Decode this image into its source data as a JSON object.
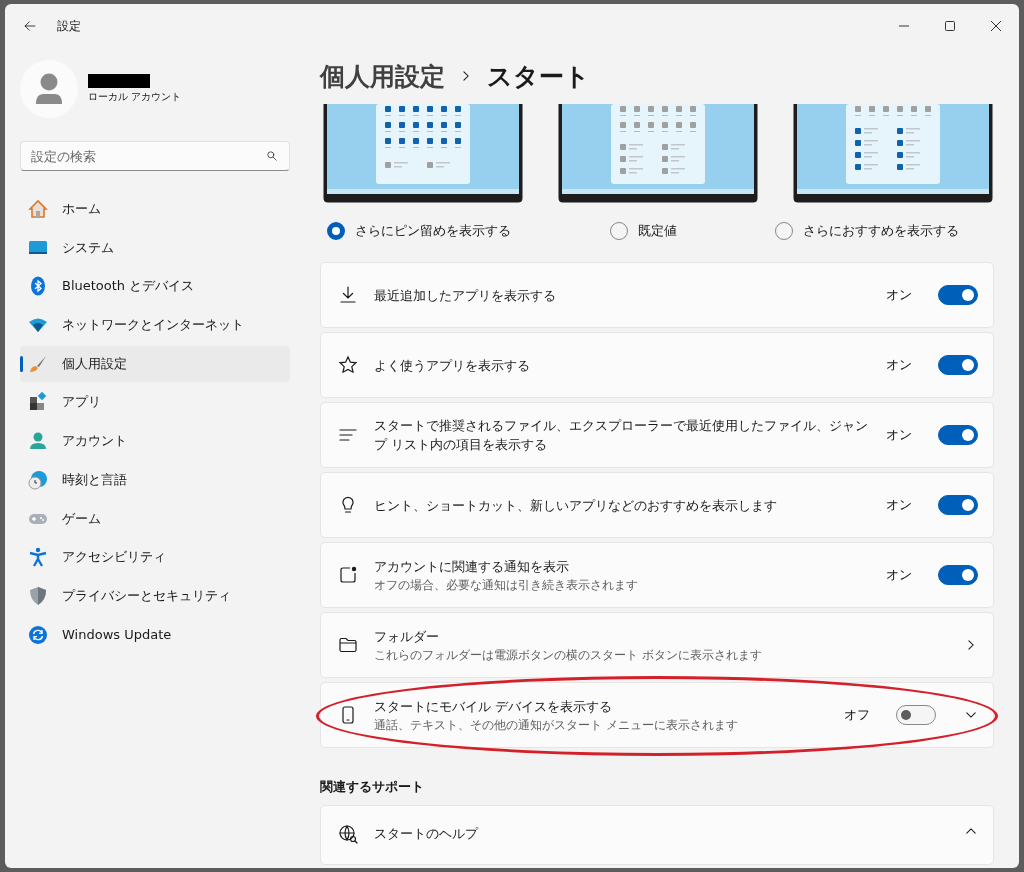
{
  "window": {
    "title": "設定"
  },
  "account": {
    "type": "ローカル アカウント"
  },
  "search": {
    "placeholder": "設定の検索"
  },
  "sidebar": {
    "items": [
      {
        "label": "ホーム",
        "selected": false
      },
      {
        "label": "システム",
        "selected": false
      },
      {
        "label": "Bluetooth とデバイス",
        "selected": false
      },
      {
        "label": "ネットワークとインターネット",
        "selected": false
      },
      {
        "label": "個人用設定",
        "selected": true
      },
      {
        "label": "アプリ",
        "selected": false
      },
      {
        "label": "アカウント",
        "selected": false
      },
      {
        "label": "時刻と言語",
        "selected": false
      },
      {
        "label": "ゲーム",
        "selected": false
      },
      {
        "label": "アクセシビリティ",
        "selected": false
      },
      {
        "label": "プライバシーとセキュリティ",
        "selected": false
      },
      {
        "label": "Windows Update",
        "selected": false
      }
    ]
  },
  "breadcrumb": {
    "parent": "個人用設定",
    "current": "スタート"
  },
  "layouts": [
    {
      "kind": "pins",
      "label": "さらにピン留めを表示する",
      "selected": true
    },
    {
      "kind": "default",
      "label": "既定値",
      "selected": false
    },
    {
      "kind": "recommendations",
      "label": "さらにおすすめを表示する",
      "selected": false
    }
  ],
  "settings": [
    {
      "kind": "toggle",
      "title": "最近追加したアプリを表示する",
      "state": "オン",
      "on": true
    },
    {
      "kind": "toggle",
      "title": "よく使うアプリを表示する",
      "state": "オン",
      "on": true
    },
    {
      "kind": "toggle",
      "title": "スタートで推奨されるファイル、エクスプローラーで最近使用したファイル、ジャンプ リスト内の項目を表示する",
      "state": "オン",
      "on": true
    },
    {
      "kind": "toggle",
      "title": "ヒント、ショートカット、新しいアプリなどのおすすめを表示します",
      "state": "オン",
      "on": true
    },
    {
      "kind": "toggle",
      "title": "アカウントに関連する通知を表示",
      "subtitle": "オフの場合、必要な通知は引き続き表示されます",
      "state": "オン",
      "on": true
    },
    {
      "kind": "link",
      "title": "フォルダー",
      "subtitle": "これらのフォルダーは電源ボタンの横のスタート ボタンに表示されます"
    },
    {
      "kind": "toggle_expand",
      "title": "スタートにモバイル デバイスを表示する",
      "subtitle": "通話、テキスト、その他の通知がスタート メニューに表示されます",
      "state": "オフ",
      "on": false,
      "expanded": false,
      "highlighted": true
    }
  ],
  "related": {
    "heading": "関連するサポート",
    "items": [
      {
        "title": "スタートのヘルプ",
        "expanded": true
      }
    ]
  }
}
